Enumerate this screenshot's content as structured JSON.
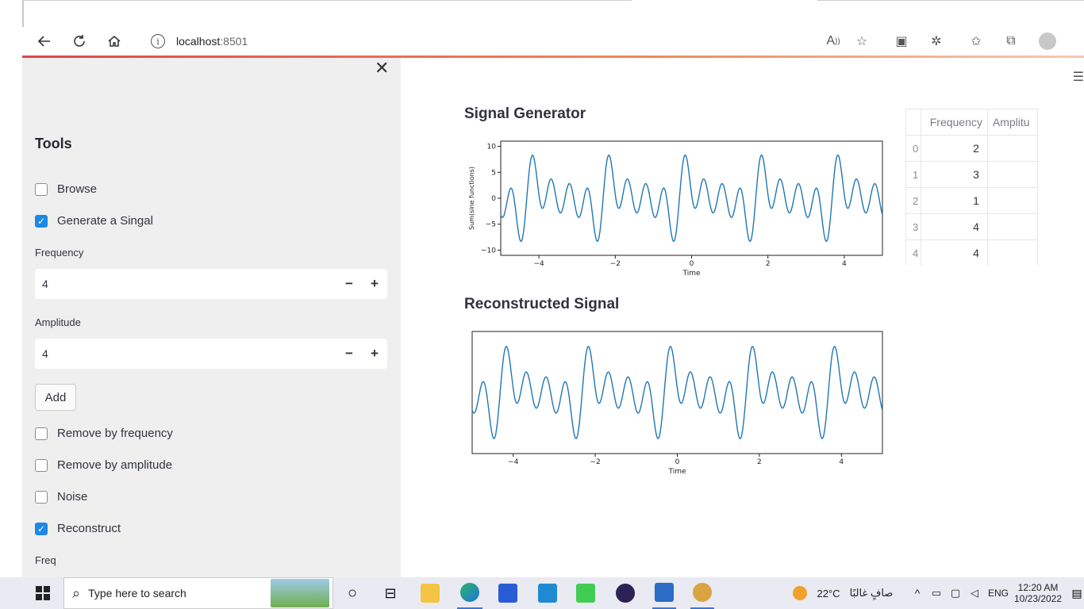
{
  "browser": {
    "url_host": "localhost",
    "url_port": ":8501"
  },
  "sidebar": {
    "title": "Tools",
    "browse_label": "Browse",
    "generate_label": "Generate a Singal",
    "frequency_label": "Frequency",
    "frequency_value": "4",
    "amplitude_label": "Amplitude",
    "amplitude_value": "4",
    "minus": "−",
    "plus": "+",
    "add_label": "Add",
    "remove_freq_label": "Remove by frequency",
    "remove_amp_label": "Remove by amplitude",
    "noise_label": "Noise",
    "reconstruct_label": "Reconstruct",
    "freq_label": "Freq",
    "close": "✕",
    "checked": {
      "browse": false,
      "generate": true,
      "remove_freq": false,
      "remove_amp": false,
      "noise": false,
      "reconstruct": true
    }
  },
  "main": {
    "generator_title": "Signal Generator",
    "reconstructed_title": "Reconstructed Signal",
    "table": {
      "headers": [
        "",
        "Frequency",
        "Amplitu"
      ],
      "rows": [
        {
          "idx": "0",
          "freq": "2"
        },
        {
          "idx": "1",
          "freq": "3"
        },
        {
          "idx": "2",
          "freq": "1"
        },
        {
          "idx": "3",
          "freq": "4"
        },
        {
          "idx": "4",
          "freq": "4"
        }
      ]
    }
  },
  "chart_data": [
    {
      "type": "line",
      "xlabel": "Time",
      "ylabel": "Sum(sine functions)",
      "xlim": [
        -5,
        5
      ],
      "ylim": [
        -11,
        11
      ],
      "xticks": [
        "−4",
        "−2",
        "0",
        "2",
        "4"
      ],
      "yticks": [
        "10",
        "5",
        "0",
        "−5",
        "−10"
      ],
      "color": "#1f77b4",
      "components": [
        {
          "freq": 2
        },
        {
          "freq": 3
        },
        {
          "freq": 1
        },
        {
          "freq": 4
        },
        {
          "freq": 4
        }
      ]
    },
    {
      "type": "line",
      "xlabel": "Time",
      "ylabel": "",
      "xlim": [
        -5,
        5
      ],
      "xticks": [
        "−4",
        "−2",
        "0",
        "2",
        "4"
      ],
      "color": "#1f77b4"
    }
  ],
  "taskbar": {
    "search_placeholder": "Type here to search",
    "weather_temp": "22°C",
    "weather_text": "صافٍ غالبًا",
    "lang": "ENG",
    "time": "12:20 AM",
    "date": "10/23/2022"
  }
}
